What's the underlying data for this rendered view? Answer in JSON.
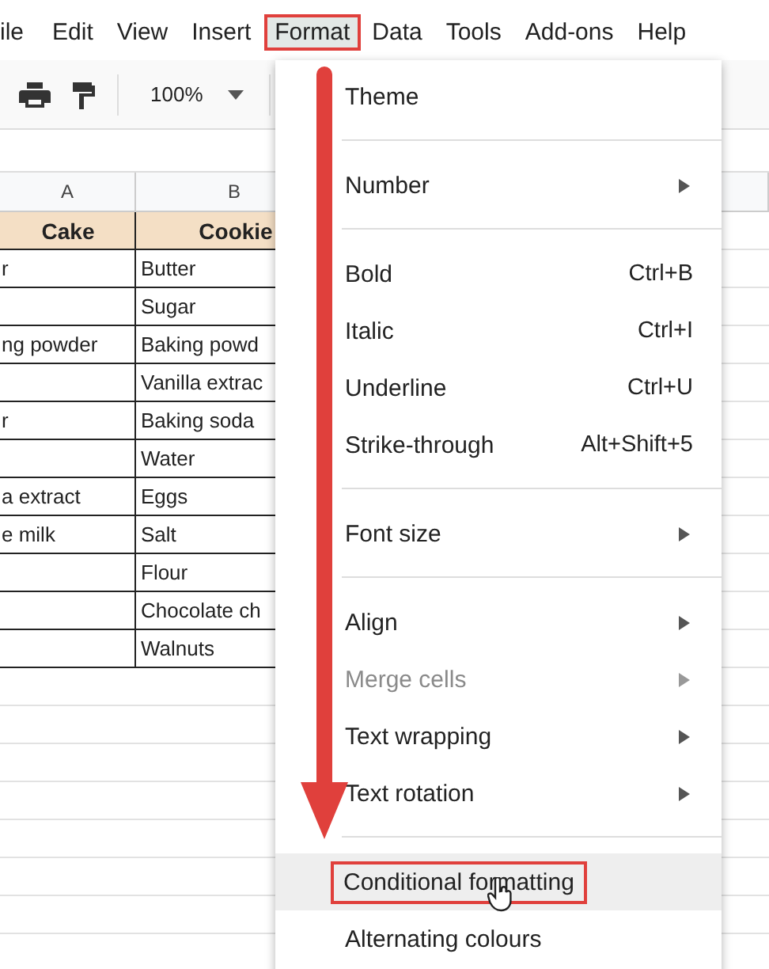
{
  "menubar": [
    {
      "label": "ile",
      "selected": false
    },
    {
      "label": "Edit",
      "selected": false
    },
    {
      "label": "View",
      "selected": false
    },
    {
      "label": "Insert",
      "selected": false
    },
    {
      "label": "Format",
      "selected": true
    },
    {
      "label": "Data",
      "selected": false
    },
    {
      "label": "Tools",
      "selected": false
    },
    {
      "label": "Add-ons",
      "selected": false
    },
    {
      "label": "Help",
      "selected": false
    }
  ],
  "toolbar": {
    "zoom": "100%"
  },
  "sheet": {
    "columns": [
      "A",
      "B"
    ],
    "rows": [
      [
        "Cake",
        "Cookie"
      ],
      [
        "r",
        "Butter"
      ],
      [
        "",
        "Sugar"
      ],
      [
        "ng powder",
        "Baking powd"
      ],
      [
        "",
        "Vanilla extrac"
      ],
      [
        "r",
        "Baking soda"
      ],
      [
        "",
        "Water"
      ],
      [
        "a extract",
        "Eggs"
      ],
      [
        "e milk",
        "Salt"
      ],
      [
        "",
        "Flour"
      ],
      [
        "",
        "Chocolate ch"
      ],
      [
        "",
        "Walnuts"
      ]
    ]
  },
  "format_menu": [
    {
      "kind": "item",
      "label": "Theme",
      "submenu": false,
      "disabled": false,
      "highlighted": false
    },
    {
      "kind": "divider"
    },
    {
      "kind": "item",
      "label": "Number",
      "submenu": true,
      "disabled": false,
      "highlighted": false
    },
    {
      "kind": "divider"
    },
    {
      "kind": "item",
      "label": "Bold",
      "shortcut": "Ctrl+B",
      "submenu": false,
      "disabled": false,
      "highlighted": false
    },
    {
      "kind": "item",
      "label": "Italic",
      "shortcut": "Ctrl+I",
      "submenu": false,
      "disabled": false,
      "highlighted": false
    },
    {
      "kind": "item",
      "label": "Underline",
      "shortcut": "Ctrl+U",
      "submenu": false,
      "disabled": false,
      "highlighted": false
    },
    {
      "kind": "item",
      "label": "Strike-through",
      "shortcut": "Alt+Shift+5",
      "submenu": false,
      "disabled": false,
      "highlighted": false
    },
    {
      "kind": "divider"
    },
    {
      "kind": "item",
      "label": "Font size",
      "submenu": true,
      "disabled": false,
      "highlighted": false
    },
    {
      "kind": "divider"
    },
    {
      "kind": "item",
      "label": "Align",
      "submenu": true,
      "disabled": false,
      "highlighted": false
    },
    {
      "kind": "item",
      "label": "Merge cells",
      "submenu": true,
      "disabled": true,
      "highlighted": false
    },
    {
      "kind": "item",
      "label": "Text wrapping",
      "submenu": true,
      "disabled": false,
      "highlighted": false
    },
    {
      "kind": "item",
      "label": "Text rotation",
      "submenu": true,
      "disabled": false,
      "highlighted": false
    },
    {
      "kind": "divider"
    },
    {
      "kind": "item",
      "label": "Conditional formatting",
      "submenu": false,
      "disabled": false,
      "highlighted": true
    },
    {
      "kind": "item",
      "label": "Alternating colours",
      "submenu": false,
      "disabled": false,
      "highlighted": false
    }
  ]
}
